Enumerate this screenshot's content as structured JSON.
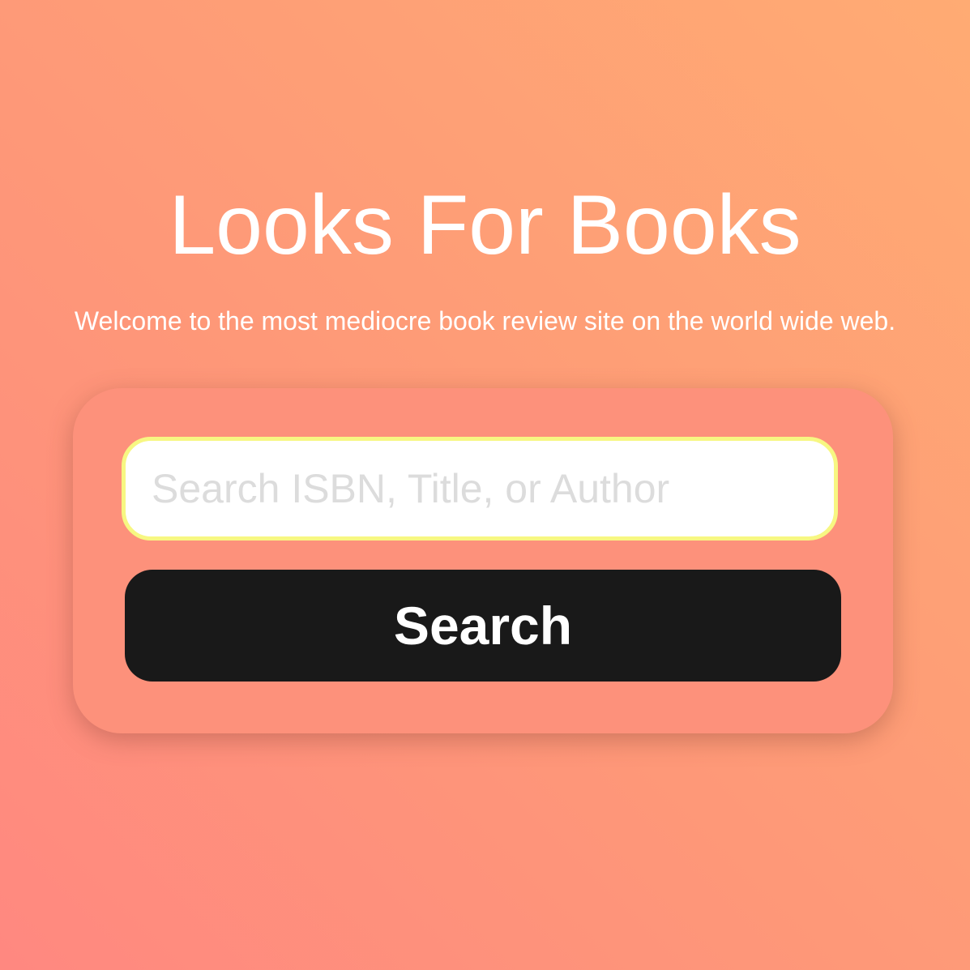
{
  "header": {
    "title": "Looks For Books",
    "subtitle": "Welcome to the most mediocre book review site on the world wide web."
  },
  "search": {
    "value": "",
    "placeholder": "Search ISBN, Title, or Author",
    "button_label": "Search"
  },
  "colors": {
    "background_gradient_start": "#ff8880",
    "background_gradient_end": "#ffab73",
    "card_background": "#fd917b",
    "input_border": "#f7f782",
    "button_background": "#191919",
    "text_light": "#ffffff",
    "placeholder": "#dcdcdc"
  }
}
